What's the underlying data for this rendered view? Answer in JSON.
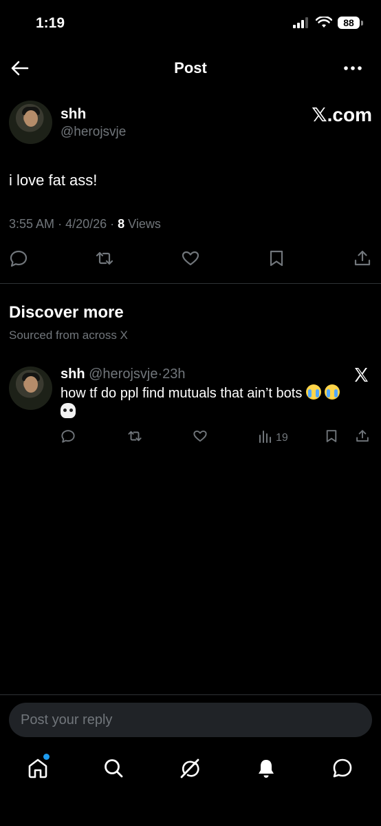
{
  "status_bar": {
    "time": "1:19",
    "battery": "88"
  },
  "nav": {
    "title": "Post",
    "back_icon": "arrow-left-icon",
    "more_icon": "more-horizontal-icon"
  },
  "post": {
    "author_name": "shh",
    "author_handle": "@herojsvje",
    "watermark": "𝕏.com",
    "text": "i love fat ass!",
    "time": "3:55 AM",
    "date": "4/20/26",
    "views_count": "8",
    "views_label": "Views"
  },
  "discover": {
    "title": "Discover more",
    "subtitle": "Sourced from across X"
  },
  "suggested_tweet": {
    "author_name": "shh",
    "author_handle": "@herojsvje",
    "separator": "·",
    "time": "23h",
    "text": "how tf do ppl find mutuals that ain’t bots",
    "emojis": [
      "loudly-crying-face",
      "loudly-crying-face",
      "skull"
    ],
    "views": "19"
  },
  "reply": {
    "placeholder": "Post your reply"
  },
  "tabs": [
    "home",
    "search",
    "grok",
    "notifications",
    "messages"
  ],
  "colors": {
    "background": "#000000",
    "muted": "#71767b",
    "accent": "#1d9bf0",
    "divider": "#2f3336"
  }
}
